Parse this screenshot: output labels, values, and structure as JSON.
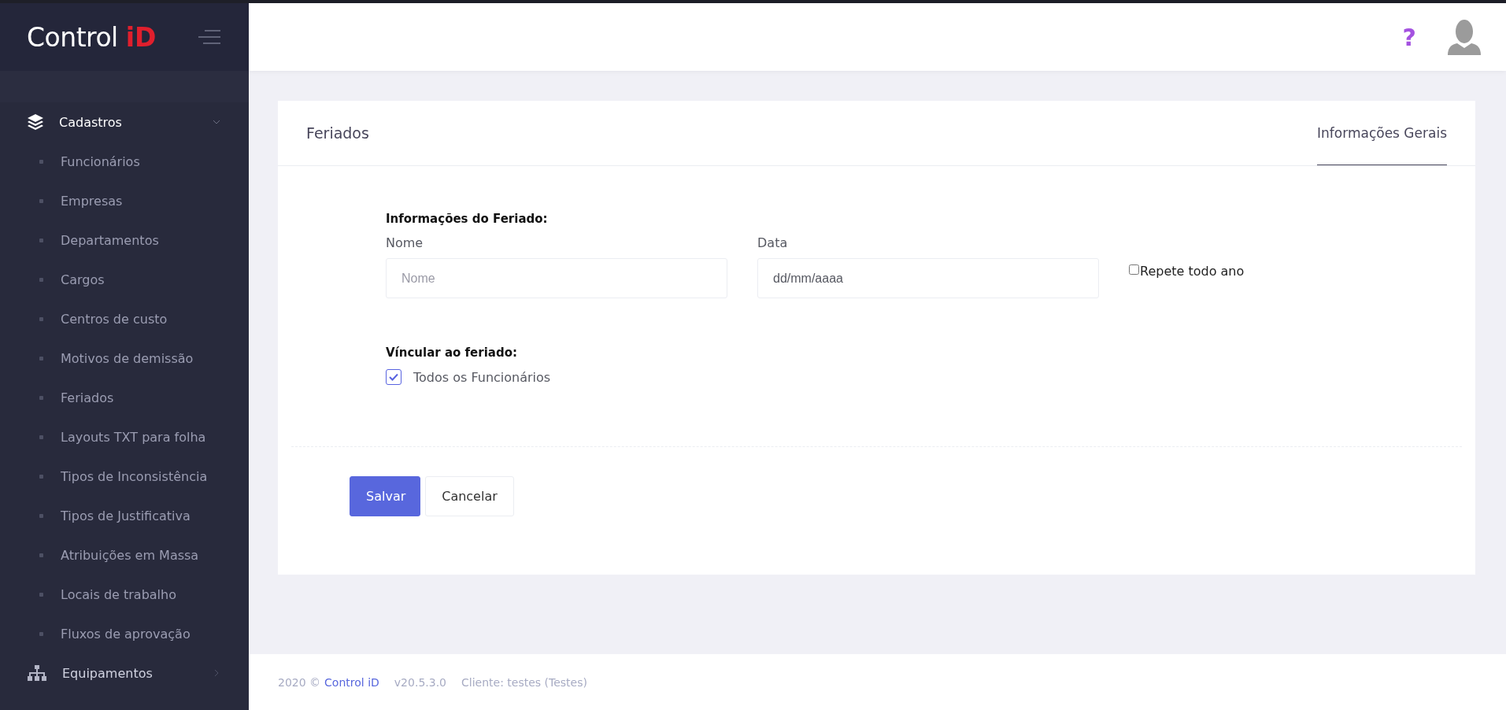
{
  "logo": {
    "text": "Control",
    "accent": "iD"
  },
  "sidebar": {
    "items": [
      {
        "label": "Cadastros",
        "expanded": true,
        "children": [
          {
            "label": "Funcionários"
          },
          {
            "label": "Empresas"
          },
          {
            "label": "Departamentos"
          },
          {
            "label": "Cargos"
          },
          {
            "label": "Centros de custo"
          },
          {
            "label": "Motivos de demissão"
          },
          {
            "label": "Feriados"
          },
          {
            "label": "Layouts TXT para folha"
          },
          {
            "label": "Tipos de Inconsistência"
          },
          {
            "label": "Tipos de Justificativa"
          },
          {
            "label": "Atribuições em Massa"
          },
          {
            "label": "Locais de trabalho"
          },
          {
            "label": "Fluxos de aprovação"
          }
        ]
      },
      {
        "label": "Equipamentos",
        "expanded": false
      }
    ]
  },
  "header": {
    "help": "?"
  },
  "card": {
    "title": "Feriados",
    "tabs": [
      {
        "label": "Informações Gerais",
        "selected": true
      }
    ],
    "section1": "Informações do Feriado:",
    "fields": [
      {
        "label": "Nome",
        "placeholder": "Nome"
      },
      {
        "label": "Data",
        "value": "dd/mm/aaaa"
      }
    ],
    "repeat": {
      "label": "Repete todo ano",
      "checked": false
    },
    "section2": "Víncular ao feriado:",
    "link": {
      "label": "Todos os Funcionários",
      "checked": true
    },
    "buttons": [
      {
        "label": "Salvar",
        "kind": "primary"
      },
      {
        "label": "Cancelar",
        "kind": "secondary"
      }
    ]
  },
  "footer": {
    "year": "2020 ©",
    "brand": "Control iD",
    "version": "v20.5.3.0",
    "client": "Cliente: testes (Testes)"
  }
}
